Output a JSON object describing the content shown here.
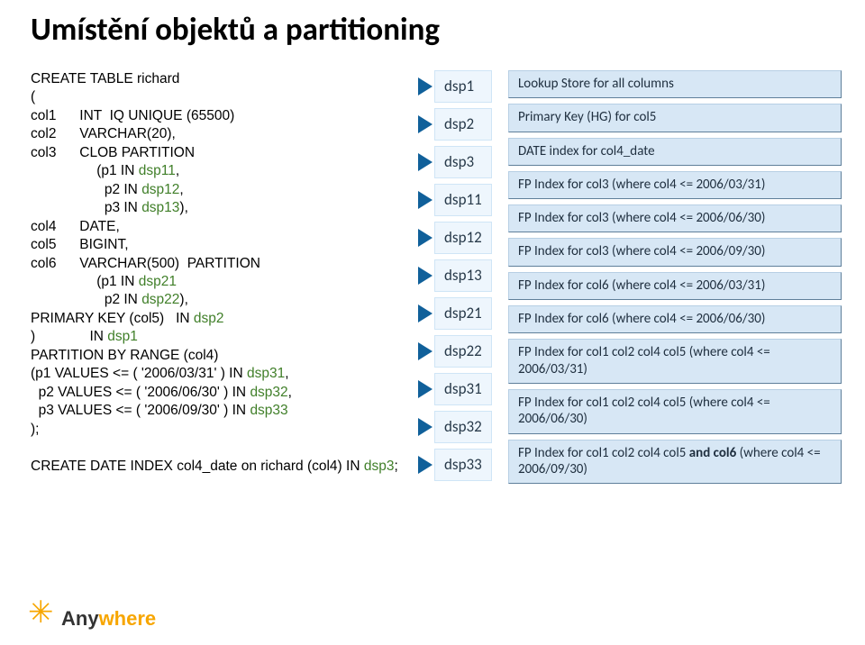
{
  "title": "Umístění objektů a partitioning",
  "sql": {
    "l1": "CREATE TABLE richard",
    "l2": "(",
    "l3a": "col1      INT  IQ UNIQUE (65500)",
    "l4a": "col2      VARCHAR(20),",
    "l5a": "col3      CLOB PARTITION",
    "l6a": "                 (p1 IN ",
    "l6b": "dsp11",
    "l6c": ",",
    "l7a": "                   p2 IN ",
    "l7b": "dsp12",
    "l7c": ",",
    "l8a": "                   p3 IN ",
    "l8b": "dsp13",
    "l8c": "),",
    "l9a": "col4      DATE,",
    "l10a": "col5      BIGINT,",
    "l11a": "col6      VARCHAR(500)  PARTITION",
    "l12a": "                 (p1 IN ",
    "l12b": "dsp21",
    "l13a": "                   p2 IN ",
    "l13b": "dsp22",
    "l13c": "),",
    "l14a": "PRIMARY KEY (col5)   IN ",
    "l14b": "dsp2",
    "l15a": ")              IN ",
    "l15b": "dsp1",
    "l16a": "PARTITION BY RANGE (col4)",
    "l17a": "(p1 VALUES <= ( '2006/03/31' ) IN ",
    "l17b": "dsp31",
    "l17c": ",",
    "l18a": "  p2 VALUES <= ( '2006/06/30' ) IN ",
    "l18b": "dsp32",
    "l18c": ",",
    "l19a": "  p3 VALUES <= ( '2006/09/30' ) IN ",
    "l19b": "dsp33",
    "l20a": ");",
    "l21a": "CREATE DATE INDEX col4_date on richard (col4) IN ",
    "l21b": "dsp3",
    "l21c": ";"
  },
  "badges": {
    "b1": "dsp1",
    "b2": "dsp2",
    "b3": "dsp3",
    "b11": "dsp11",
    "b12": "dsp12",
    "b13": "dsp13",
    "b21": "dsp21",
    "b22": "dsp22",
    "b31": "dsp31",
    "b32": "dsp32",
    "b33": "dsp33"
  },
  "boxes": {
    "r1": "Lookup Store for all columns",
    "r2": "Primary Key (HG) for col5",
    "r3": "DATE index for  col4_date",
    "r4": "FP Index for col3 (where col4 <= 2006/03/31)",
    "r5": "FP Index for col3 (where col4 <= 2006/06/30)",
    "r6": "FP Index for col3 (where col4 <= 2006/09/30)",
    "r7": "FP Index for col6 (where col4 <= 2006/03/31)",
    "r8": "FP Index for col6 (where col4 <= 2006/06/30)",
    "r9a": "FP Index for col1 col2 col4 col5 (where col4 <= 2006/03/31)",
    "r10a": "FP Index for col1 col2 col4 col5 (where col4 <= 2006/06/30)",
    "r11a": "FP Index for col1 col2 col4 col5 ",
    "r11b": "and col6",
    "r11c": "  (where col4 <= 2006/09/30)"
  },
  "logo": {
    "any": "Any",
    "where": "where"
  }
}
